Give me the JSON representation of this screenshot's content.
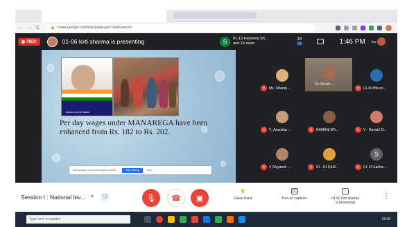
{
  "browser": {
    "nav_back": "←",
    "nav_forward": "→",
    "nav_reload": "C",
    "lock": "🔒",
    "url": "meet.google.com/mq-bswp-pyz?authuser=1"
  },
  "meet_header": {
    "rec_label": "REC",
    "presenting_text": "01-06 kirti sharma is presenting",
    "participant_avatar_letter": "S",
    "participant_line1": "01-13 Haseena Sh...",
    "participant_line2": "and 16 more",
    "people_count": "28",
    "time": "1:46 PM",
    "you_label": "You"
  },
  "slide": {
    "gandhi_caption": "Mahatma Gandhi NREGA",
    "text": "Per day wages under MANAREGA have been enhanced from Rs. 182 to Rs. 202.",
    "share_notice": "meet.google.com is sharing your screen.",
    "stop_sharing": "Stop sharing",
    "hide": "Hide"
  },
  "participants": [
    {
      "name": "Ms. Shweta ..."
    },
    {
      "name": "01-06 kirti ..."
    },
    {
      "name": "01-09 Bhuvn..."
    },
    {
      "name": "V_Anamika ..."
    },
    {
      "name": "RAMANI BH..."
    },
    {
      "name": "V - Gayatri G..."
    },
    {
      "name": "V Divyansh ..."
    },
    {
      "name": "01 - 01 KAM..."
    },
    {
      "name": "01-13 Sadha..."
    }
  ],
  "participant_letter_s": "S",
  "bottom": {
    "session_label": "Session I : National lev...",
    "raise_hand": "Raise hand",
    "captions": "Turn on captions",
    "presenting_line1": "01-06 kirti sharma",
    "presenting_line2": "is presenting",
    "more": "⋮"
  },
  "taskbar": {
    "search_placeholder": "Type here to search",
    "time": "13:46"
  }
}
